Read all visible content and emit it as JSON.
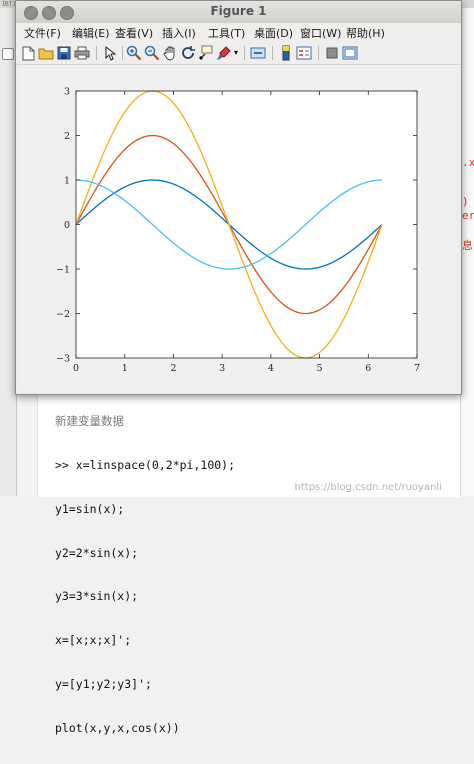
{
  "figure": {
    "title": "Figure 1",
    "menu": [
      {
        "name": "file",
        "label": "文件(F)"
      },
      {
        "name": "edit",
        "label": "编辑(E)"
      },
      {
        "name": "view",
        "label": "查看(V)"
      },
      {
        "name": "insert",
        "label": "插入(I)"
      },
      {
        "name": "tools",
        "label": "工具(T)"
      },
      {
        "name": "desktop",
        "label": "桌面(D)"
      },
      {
        "name": "window",
        "label": "窗口(W)"
      },
      {
        "name": "help",
        "label": "帮助(H)"
      }
    ],
    "toolbar_icons": [
      "new-figure-icon",
      "open-file-icon",
      "save-icon",
      "print-icon",
      "edit-plot-icon",
      "zoom-in-icon",
      "zoom-out-icon",
      "pan-icon",
      "rotate-3d-icon",
      "data-cursor-icon",
      "brush-icon",
      "brush-dropdown-icon",
      "link-plot-icon",
      "insert-colorbar-icon",
      "insert-legend-icon",
      "hide-plot-tools-icon",
      "show-plot-tools-icon"
    ]
  },
  "colors": {
    "series_1": "#0072bd",
    "series_2": "#d95319",
    "series_3": "#edb120",
    "series_4": "#4dbeee"
  },
  "command_window": {
    "lines": [
      "新建变量数据",
      ">> x=linspace(0,2*pi,100);",
      "y1=sin(x);",
      "y2=2*sin(x);",
      "y3=3*sin(x);",
      "x=[x;x;x]';",
      "y=[y1;y2;y3]';",
      "plot(x,y,x,cos(x))"
    ]
  },
  "right_panel_fragments": [
    ".x",
    ")",
    "er",
    "息"
  ],
  "watermark": "https://blog.csdn.net/ruoyanli",
  "chart_data": {
    "type": "line",
    "xlim": [
      0,
      7
    ],
    "ylim": [
      -3,
      3
    ],
    "xticks": [
      0,
      1,
      2,
      3,
      4,
      5,
      6,
      7
    ],
    "yticks": [
      -3,
      -2,
      -1,
      0,
      1,
      2,
      3
    ],
    "grid": false,
    "box": true,
    "x_range": [
      0,
      6.2832
    ],
    "samples": 100,
    "series": [
      {
        "expr": "sin(x)",
        "amplitude": 1,
        "func": "sin",
        "color": "#0072bd"
      },
      {
        "expr": "2*sin(x)",
        "amplitude": 2,
        "func": "sin",
        "color": "#d95319"
      },
      {
        "expr": "3*sin(x)",
        "amplitude": 3,
        "func": "sin",
        "color": "#edb120"
      },
      {
        "expr": "cos(x)",
        "amplitude": 1,
        "func": "cos",
        "color": "#4dbeee"
      }
    ]
  }
}
